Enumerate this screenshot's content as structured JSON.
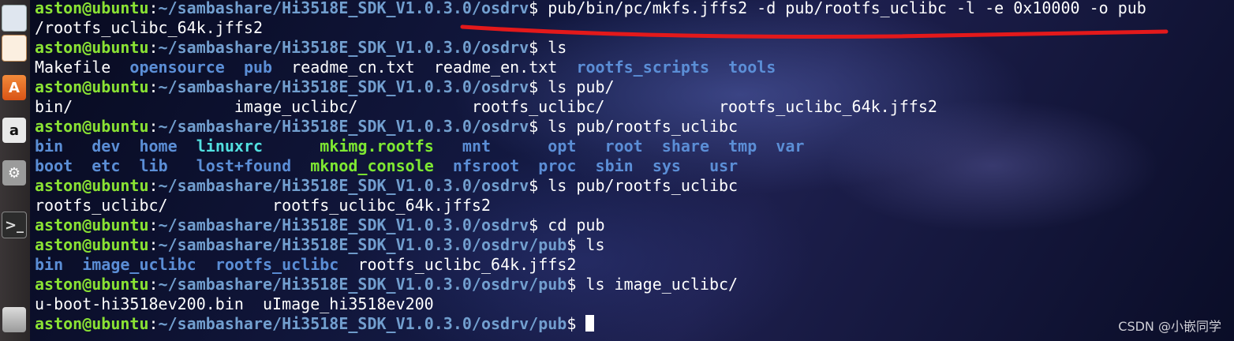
{
  "dock": {
    "items": [
      {
        "name": "office-writer-icon",
        "glyph": ""
      },
      {
        "name": "office-impress-icon",
        "glyph": ""
      },
      {
        "name": "software-center-icon",
        "glyph": "A"
      },
      {
        "name": "amazon-icon",
        "glyph": "a"
      },
      {
        "name": "system-settings-icon",
        "glyph": "⚙"
      },
      {
        "name": "terminal-icon",
        "glyph": ">_"
      },
      {
        "name": "trash-icon",
        "glyph": ""
      }
    ]
  },
  "terminal": {
    "lines": [
      {
        "type": "prompt",
        "user": "aston@ubuntu",
        "path": "~/sambashare/Hi3518E_SDK_V1.0.3.0/osdrv",
        "cmd": "pub/bin/pc/mkfs.jffs2 -d pub/rootfs_uclibc -l -e 0x10000 -o pub"
      },
      {
        "type": "out",
        "tokens": [
          {
            "text": "/rootfs_uclibc_64k.jffs2",
            "style": "w"
          }
        ]
      },
      {
        "type": "prompt",
        "user": "aston@ubuntu",
        "path": "~/sambashare/Hi3518E_SDK_V1.0.3.0/osdrv",
        "cmd": "ls"
      },
      {
        "type": "out",
        "tokens": [
          {
            "text": "Makefile",
            "style": "w"
          },
          {
            "text": "  "
          },
          {
            "text": "opensource",
            "style": "dir"
          },
          {
            "text": "  "
          },
          {
            "text": "pub",
            "style": "dir"
          },
          {
            "text": "  "
          },
          {
            "text": "readme_cn.txt",
            "style": "w"
          },
          {
            "text": "  "
          },
          {
            "text": "readme_en.txt",
            "style": "w"
          },
          {
            "text": "  "
          },
          {
            "text": "rootfs_scripts",
            "style": "dir"
          },
          {
            "text": "  "
          },
          {
            "text": "tools",
            "style": "dir"
          }
        ]
      },
      {
        "type": "prompt",
        "user": "aston@ubuntu",
        "path": "~/sambashare/Hi3518E_SDK_V1.0.3.0/osdrv",
        "cmd": "ls pub/"
      },
      {
        "type": "out",
        "tokens": [
          {
            "text": "bin/                 image_uclibc/            rootfs_uclibc/            rootfs_uclibc_64k.jffs2",
            "style": "w"
          }
        ]
      },
      {
        "type": "prompt",
        "user": "aston@ubuntu",
        "path": "~/sambashare/Hi3518E_SDK_V1.0.3.0/osdrv",
        "cmd": "ls pub/rootfs_uclibc"
      },
      {
        "type": "out",
        "tokens": [
          {
            "text": "bin",
            "style": "dir"
          },
          {
            "text": "   "
          },
          {
            "text": "dev",
            "style": "dir"
          },
          {
            "text": "  "
          },
          {
            "text": "home",
            "style": "dir"
          },
          {
            "text": "  "
          },
          {
            "text": "linuxrc",
            "style": "lnk"
          },
          {
            "text": "      "
          },
          {
            "text": "mkimg.rootfs",
            "style": "exe"
          },
          {
            "text": "   "
          },
          {
            "text": "mnt",
            "style": "dir"
          },
          {
            "text": "      "
          },
          {
            "text": "opt",
            "style": "dir"
          },
          {
            "text": "   "
          },
          {
            "text": "root",
            "style": "dir"
          },
          {
            "text": "  "
          },
          {
            "text": "share",
            "style": "dir"
          },
          {
            "text": "  "
          },
          {
            "text": "tmp",
            "style": "dir"
          },
          {
            "text": "  "
          },
          {
            "text": "var",
            "style": "dir"
          }
        ]
      },
      {
        "type": "out",
        "tokens": [
          {
            "text": "boot",
            "style": "dir"
          },
          {
            "text": "  "
          },
          {
            "text": "etc",
            "style": "dir"
          },
          {
            "text": "  "
          },
          {
            "text": "lib",
            "style": "dir"
          },
          {
            "text": "   "
          },
          {
            "text": "lost+found",
            "style": "dir"
          },
          {
            "text": "  "
          },
          {
            "text": "mknod_console",
            "style": "exe"
          },
          {
            "text": "  "
          },
          {
            "text": "nfsroot",
            "style": "dir"
          },
          {
            "text": "  "
          },
          {
            "text": "proc",
            "style": "dir"
          },
          {
            "text": "  "
          },
          {
            "text": "sbin",
            "style": "dir"
          },
          {
            "text": "  "
          },
          {
            "text": "sys",
            "style": "dir"
          },
          {
            "text": "   "
          },
          {
            "text": "usr",
            "style": "dir"
          }
        ]
      },
      {
        "type": "prompt",
        "user": "aston@ubuntu",
        "path": "~/sambashare/Hi3518E_SDK_V1.0.3.0/osdrv",
        "cmd": "ls pub/rootfs_uclibc"
      },
      {
        "type": "out",
        "tokens": [
          {
            "text": "rootfs_uclibc/           rootfs_uclibc_64k.jffs2",
            "style": "w"
          }
        ]
      },
      {
        "type": "prompt",
        "user": "aston@ubuntu",
        "path": "~/sambashare/Hi3518E_SDK_V1.0.3.0/osdrv",
        "cmd": "cd pub"
      },
      {
        "type": "prompt",
        "user": "aston@ubuntu",
        "path": "~/sambashare/Hi3518E_SDK_V1.0.3.0/osdrv/pub",
        "cmd": "ls"
      },
      {
        "type": "out",
        "tokens": [
          {
            "text": "bin",
            "style": "dir"
          },
          {
            "text": "  "
          },
          {
            "text": "image_uclibc",
            "style": "dir"
          },
          {
            "text": "  "
          },
          {
            "text": "rootfs_uclibc",
            "style": "dir"
          },
          {
            "text": "  "
          },
          {
            "text": "rootfs_uclibc_64k.jffs2",
            "style": "w"
          }
        ]
      },
      {
        "type": "prompt",
        "user": "aston@ubuntu",
        "path": "~/sambashare/Hi3518E_SDK_V1.0.3.0/osdrv/pub",
        "cmd": "ls image_uclibc/"
      },
      {
        "type": "out",
        "tokens": [
          {
            "text": "u-boot-hi3518ev200.bin  uImage_hi3518ev200",
            "style": "w"
          }
        ]
      },
      {
        "type": "prompt",
        "user": "aston@ubuntu",
        "path": "~/sambashare/Hi3518E_SDK_V1.0.3.0/osdrv/pub",
        "cmd": "",
        "cursor": true
      }
    ]
  },
  "annotation": {
    "color": "#e3191b"
  },
  "watermark": {
    "text": "CSDN @小嵌同学"
  }
}
